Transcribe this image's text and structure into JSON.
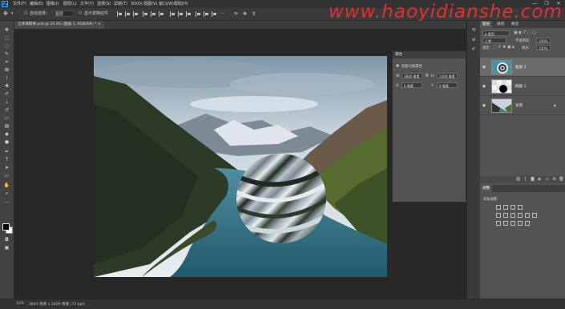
{
  "app": {
    "logo": "Ps",
    "menus": [
      "文件(F)",
      "编辑(E)",
      "图像(I)",
      "图层(L)",
      "文字(Y)",
      "选择(S)",
      "滤镜(T)",
      "3D(D)",
      "视图(V)",
      "窗口(W)",
      "帮助(H)"
    ],
    "window_controls": [
      "—",
      "❐",
      "✕"
    ]
  },
  "options_bar": {
    "auto_select_label": "自动选择：",
    "auto_select_value": "图层",
    "transform_controls_label": "显示变换控件"
  },
  "watermark": "www.haoyidianshe.com",
  "document": {
    "tab_title": "立体球转换.psd @ 33.3% (图层 1, RGB/8#) *  ×"
  },
  "properties_panel": {
    "title": "属性",
    "section": "智能对象属性",
    "width_label": "W:",
    "width_value": "3840 像素",
    "height_label": "H:",
    "height_value": "2400 像素",
    "x_label": "X:",
    "x_value": "0 像素",
    "y_label": "Y:",
    "y_value": "0 像素"
  },
  "layers_panel": {
    "tabs": [
      "图层",
      "通道",
      "路径"
    ],
    "filter_label": "ρ 类型",
    "blend_mode": "正常",
    "opacity_label": "不透明度：",
    "opacity_value": "100%",
    "lock_label": "锁定：",
    "fill_label": "填充：",
    "fill_value": "100%",
    "layers": [
      {
        "name": "图层 1",
        "selected": true
      },
      {
        "name": "椭圆 1",
        "selected": false
      },
      {
        "name": "背景",
        "selected": false
      }
    ]
  },
  "adjustments_panel": {
    "title": "调整",
    "subtitle": "添加调整"
  },
  "status_bar": {
    "zoom": "33%",
    "doc_info": "3840 像素 x 2400 像素 (72 ppi)"
  },
  "colors": {
    "watermark": "#f03030",
    "accent": "#31a8ff"
  }
}
